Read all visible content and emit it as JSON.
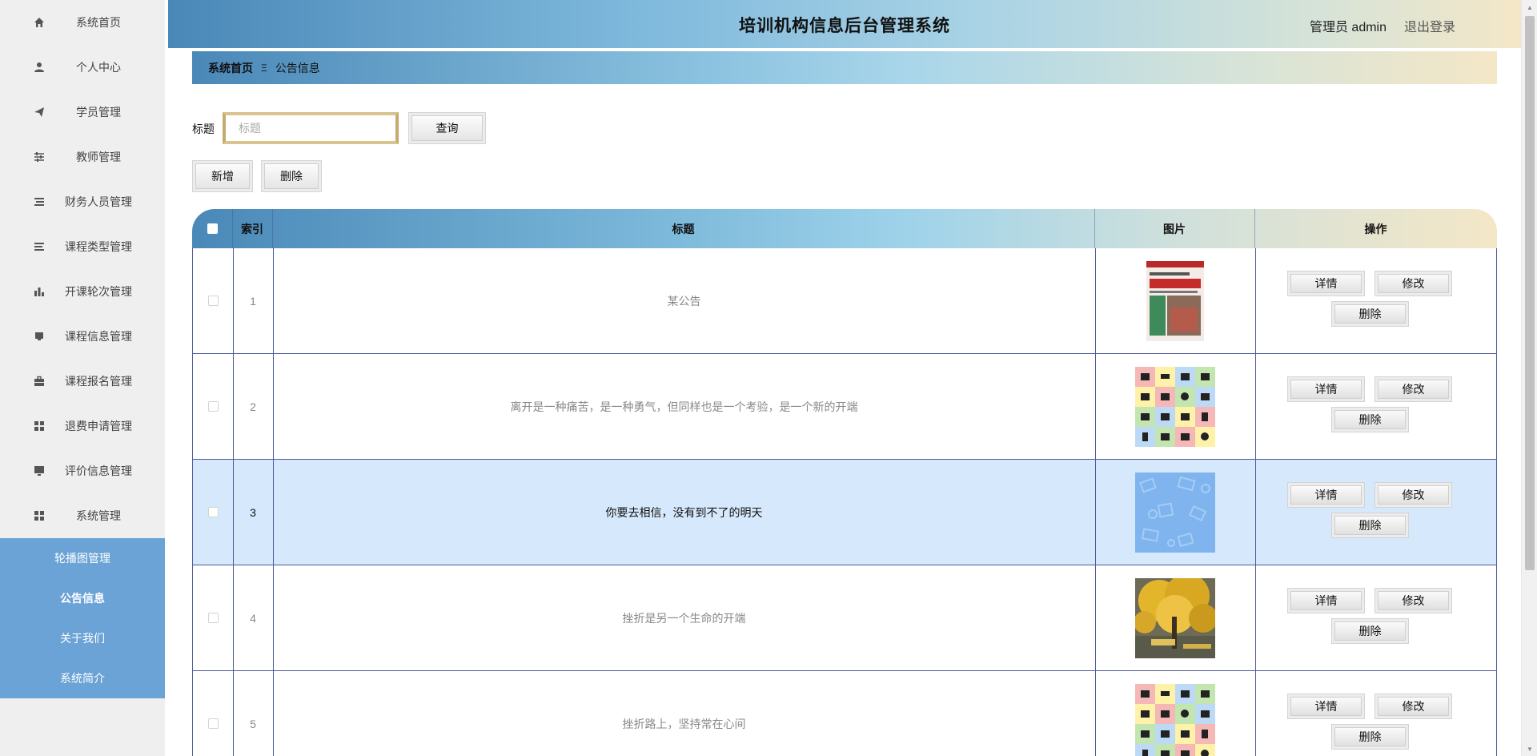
{
  "header": {
    "title": "培训机构信息后台管理系统",
    "user": "管理员 admin",
    "logout": "退出登录"
  },
  "sidebar": {
    "items": [
      {
        "label": "系统首页",
        "icon": "home-icon"
      },
      {
        "label": "个人中心",
        "icon": "user-icon"
      },
      {
        "label": "学员管理",
        "icon": "paper-plane-icon"
      },
      {
        "label": "教师管理",
        "icon": "sliders-icon"
      },
      {
        "label": "财务人员管理",
        "icon": "list-icon"
      },
      {
        "label": "课程类型管理",
        "icon": "list-icon"
      },
      {
        "label": "开课轮次管理",
        "icon": "bar-chart-icon"
      },
      {
        "label": "课程信息管理",
        "icon": "inbox-icon"
      },
      {
        "label": "课程报名管理",
        "icon": "briefcase-icon"
      },
      {
        "label": "退费申请管理",
        "icon": "grid-icon"
      },
      {
        "label": "评价信息管理",
        "icon": "monitor-icon"
      },
      {
        "label": "系统管理",
        "icon": "grid-icon"
      }
    ],
    "submenu": [
      "轮播图管理",
      "公告信息",
      "关于我们",
      "系统简介"
    ],
    "active_sub": "公告信息"
  },
  "breadcrumb": {
    "home": "系统首页",
    "separator": "Ξ",
    "current": "公告信息"
  },
  "search": {
    "label": "标题",
    "placeholder": "标题",
    "query_button": "查询"
  },
  "toolbar": {
    "add": "新增",
    "delete": "删除"
  },
  "table": {
    "headers": {
      "index": "索引",
      "title": "标题",
      "image": "图片",
      "actions": "操作"
    },
    "rows": [
      {
        "index": "1",
        "title": "某公告",
        "image": "news-book-cover"
      },
      {
        "index": "2",
        "title": "离开是一种痛苦，是一种勇气，但同样也是一个考验，是一个新的开端",
        "image": "icon-grid"
      },
      {
        "index": "3",
        "title": "你要去相信，没有到不了的明天",
        "image": "blue-pattern",
        "highlighted": true
      },
      {
        "index": "4",
        "title": "挫折是另一个生命的开端",
        "image": "autumn-tree"
      },
      {
        "index": "5",
        "title": "挫折路上，坚持常在心间",
        "image": "icon-grid"
      }
    ],
    "row_actions": {
      "detail": "详情",
      "edit": "修改",
      "delete": "删除"
    }
  },
  "colors": {
    "sidebar_bg": "#efefef",
    "submenu_bg": "#6ba3d6",
    "highlight_row": "#d6e8fb",
    "border": "#4f5a9a"
  }
}
